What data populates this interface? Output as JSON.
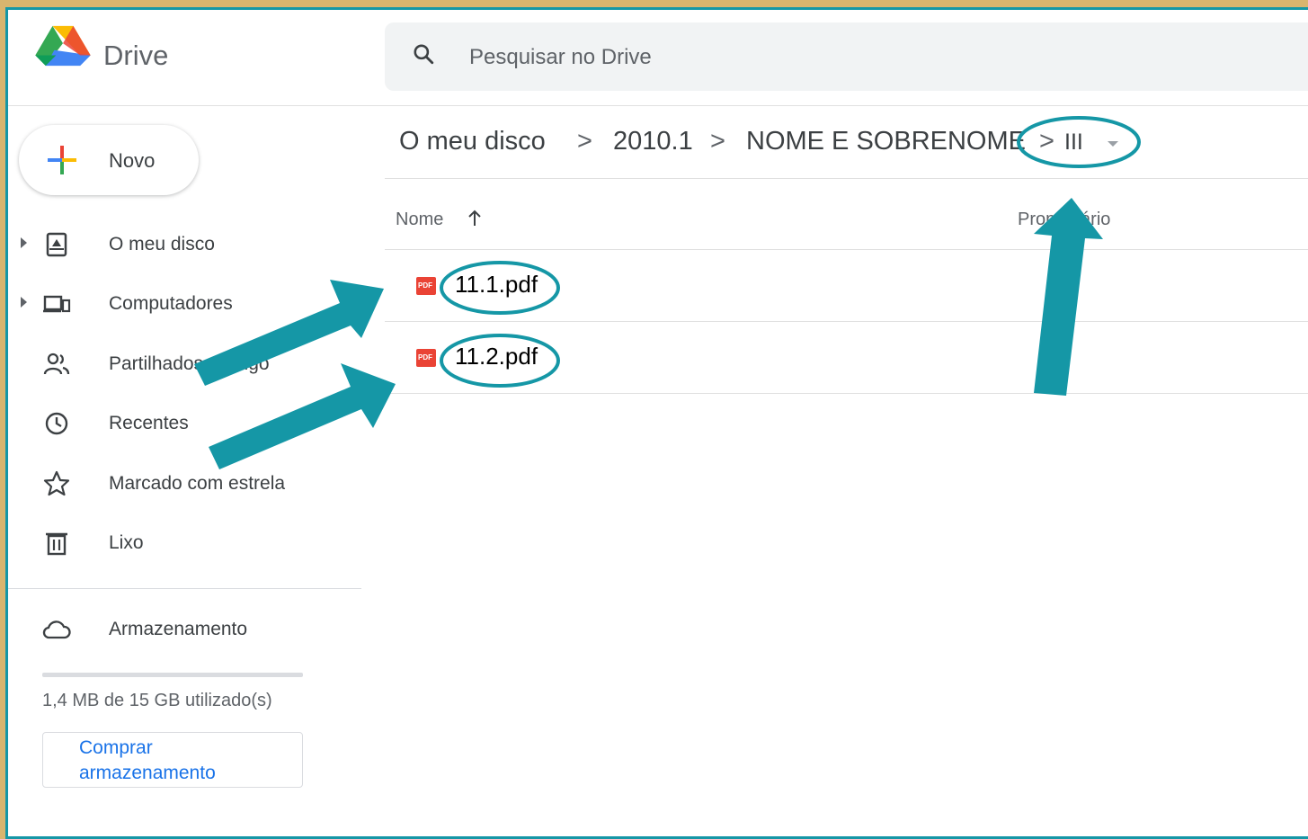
{
  "colors": {
    "annotation": "#1597a6",
    "frame": "#1597a6",
    "background": "#d9b56e",
    "accent": "#1a73e8"
  },
  "header": {
    "brand": "Drive",
    "logo_icon": "google-drive-logo",
    "search": {
      "icon": "search-icon",
      "placeholder": "Pesquisar no Drive"
    }
  },
  "sidebar": {
    "new_button": {
      "label": "Novo",
      "icon": "plus-icon"
    },
    "items": [
      {
        "label": "O meu disco",
        "icon": "my-drive-icon",
        "expandable": true
      },
      {
        "label": "Computadores",
        "icon": "computers-icon",
        "expandable": true
      },
      {
        "label": "Partilhados comigo",
        "icon": "shared-icon",
        "expandable": false
      },
      {
        "label": "Recentes",
        "icon": "clock-icon",
        "expandable": false
      },
      {
        "label": "Marcado com estrela",
        "icon": "star-icon",
        "expandable": false
      },
      {
        "label": "Lixo",
        "icon": "trash-icon",
        "expandable": false
      }
    ],
    "storage": {
      "label": "Armazenamento",
      "icon": "cloud-icon",
      "usage_text": "1,4 MB de 15 GB utilizado(s)",
      "used_fraction": 0.0001,
      "buy_label": "Comprar armazenamento"
    }
  },
  "breadcrumb": {
    "items": [
      "O meu disco",
      "2010.1",
      "NOME E SOBRENOME",
      "III"
    ],
    "separator": ">"
  },
  "table": {
    "columns": [
      "Nome",
      "Proprietário"
    ],
    "sorted_by": "Nome",
    "sort_direction": "ascending",
    "rows": [
      {
        "name": "11.1.pdf",
        "type_icon": "pdf-icon",
        "type_label": "PDF"
      },
      {
        "name": "11.2.pdf",
        "type_icon": "pdf-icon",
        "type_label": "PDF"
      }
    ]
  }
}
